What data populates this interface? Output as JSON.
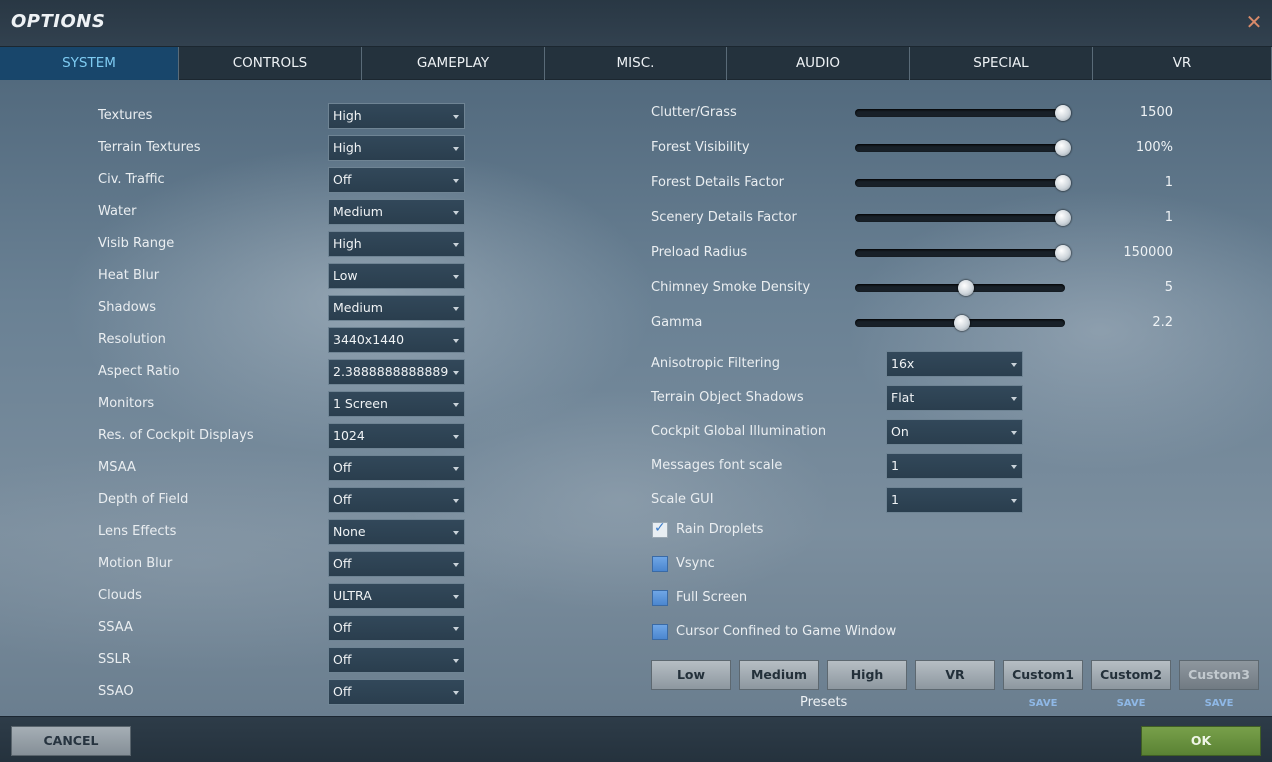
{
  "window": {
    "title": "OPTIONS",
    "close_icon": "close-icon"
  },
  "tabs": [
    {
      "label": "SYSTEM",
      "active": true
    },
    {
      "label": "CONTROLS"
    },
    {
      "label": "GAMEPLAY"
    },
    {
      "label": "MISC."
    },
    {
      "label": "AUDIO"
    },
    {
      "label": "SPECIAL"
    },
    {
      "label": "VR"
    }
  ],
  "left_settings": [
    {
      "label": "Textures",
      "value": "High"
    },
    {
      "label": "Terrain Textures",
      "value": "High"
    },
    {
      "label": "Civ. Traffic",
      "value": "Off"
    },
    {
      "label": "Water",
      "value": "Medium"
    },
    {
      "label": "Visib Range",
      "value": "High"
    },
    {
      "label": "Heat Blur",
      "value": "Low"
    },
    {
      "label": "Shadows",
      "value": "Medium"
    },
    {
      "label": "Resolution",
      "value": "3440x1440"
    },
    {
      "label": "Aspect Ratio",
      "value": "2.3888888888889"
    },
    {
      "label": "Monitors",
      "value": "1 Screen"
    },
    {
      "label": "Res. of Cockpit Displays",
      "value": "1024"
    },
    {
      "label": "MSAA",
      "value": "Off"
    },
    {
      "label": "Depth of Field",
      "value": "Off"
    },
    {
      "label": "Lens Effects",
      "value": "None"
    },
    {
      "label": "Motion Blur",
      "value": "Off"
    },
    {
      "label": "Clouds",
      "value": "ULTRA"
    },
    {
      "label": "SSAA",
      "value": "Off"
    },
    {
      "label": "SSLR",
      "value": "Off"
    },
    {
      "label": "SSAO",
      "value": "Off"
    }
  ],
  "sliders": [
    {
      "label": "Clutter/Grass",
      "value": "1500",
      "level": 1.0
    },
    {
      "label": "Forest Visibility",
      "value": "100%",
      "level": 1.0
    },
    {
      "label": "Forest Details Factor",
      "value": "1",
      "level": 1.0
    },
    {
      "label": "Scenery Details Factor",
      "value": "1",
      "level": 1.0
    },
    {
      "label": "Preload Radius",
      "value": "150000",
      "level": 1.0
    },
    {
      "label": "Chimney Smoke Density",
      "value": "5",
      "level": 0.5
    },
    {
      "label": "Gamma",
      "value": "2.2",
      "level": 0.48
    }
  ],
  "right_dropdowns": [
    {
      "label": "Anisotropic Filtering",
      "value": "16x"
    },
    {
      "label": "Terrain Object Shadows",
      "value": "Flat"
    },
    {
      "label": "Cockpit Global Illumination",
      "value": "On"
    },
    {
      "label": "Messages font scale",
      "value": "1"
    },
    {
      "label": "Scale GUI",
      "value": "1"
    }
  ],
  "checkboxes": [
    {
      "label": "Rain Droplets",
      "checked": true
    },
    {
      "label": "Vsync",
      "checked": false
    },
    {
      "label": "Full Screen",
      "checked": false
    },
    {
      "label": "Cursor Confined to Game Window",
      "checked": false
    }
  ],
  "presets": {
    "label": "Presets",
    "buttons": [
      {
        "label": "Low"
      },
      {
        "label": "Medium"
      },
      {
        "label": "High"
      },
      {
        "label": "VR"
      },
      {
        "label": "Custom1",
        "save": "SAVE"
      },
      {
        "label": "Custom2",
        "save": "SAVE"
      },
      {
        "label": "Custom3",
        "save": "SAVE",
        "disabled": true
      }
    ]
  },
  "footer": {
    "cancel": "CANCEL",
    "ok": "OK"
  },
  "colors": {
    "accent_tab": "#7ecbf2",
    "ok_green": "#6a9440",
    "checkbox_blue": "#5a93d8"
  }
}
